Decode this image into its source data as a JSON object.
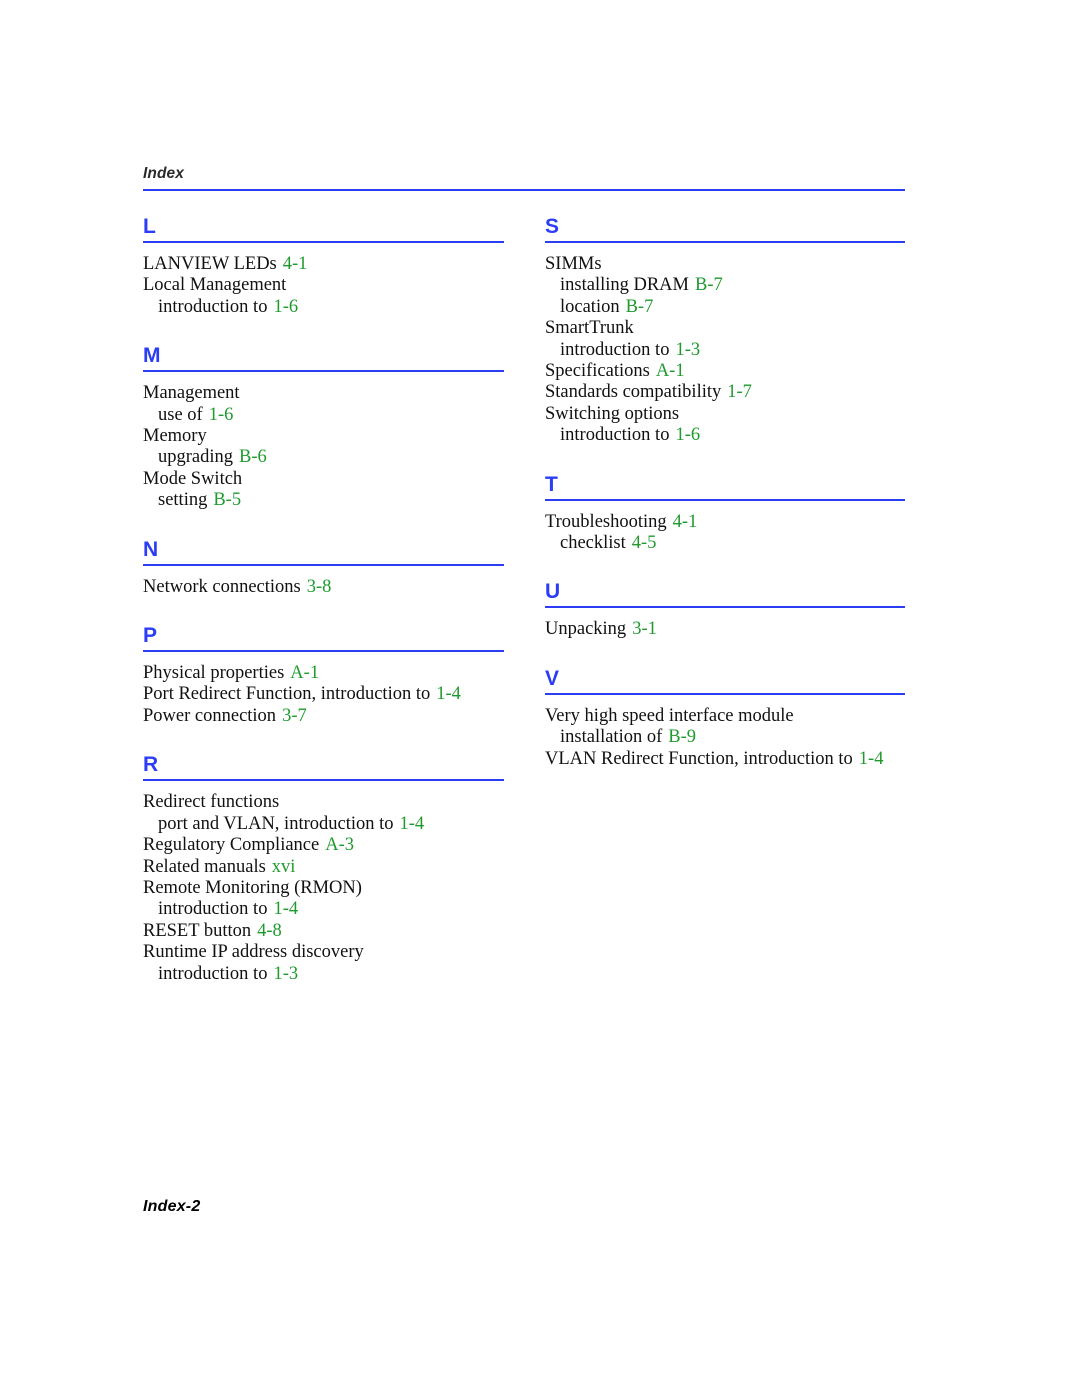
{
  "header": {
    "title": "Index"
  },
  "footer": {
    "page_label": "Index-2"
  },
  "colors": {
    "accent_blue": "#2b3df5",
    "page_number_green": "#1f9b2e",
    "body_text": "#111111"
  },
  "columns": [
    {
      "name": "left-column",
      "sections": [
        {
          "letter": "L",
          "entries": [
            {
              "term": "LANVIEW LEDs",
              "page": "4-1",
              "level": 0
            },
            {
              "term": "Local Management",
              "page": "",
              "level": 0
            },
            {
              "term": "introduction to",
              "page": "1-6",
              "level": 1
            }
          ]
        },
        {
          "letter": "M",
          "entries": [
            {
              "term": "Management",
              "page": "",
              "level": 0
            },
            {
              "term": "use of",
              "page": "1-6",
              "level": 1
            },
            {
              "term": "Memory",
              "page": "",
              "level": 0
            },
            {
              "term": "upgrading",
              "page": "B-6",
              "level": 1
            },
            {
              "term": "Mode Switch",
              "page": "",
              "level": 0
            },
            {
              "term": "setting",
              "page": "B-5",
              "level": 1
            }
          ]
        },
        {
          "letter": "N",
          "entries": [
            {
              "term": "Network connections",
              "page": "3-8",
              "level": 0
            }
          ]
        },
        {
          "letter": "P",
          "entries": [
            {
              "term": "Physical properties",
              "page": "A-1",
              "level": 0
            },
            {
              "term": "Port Redirect Function, introduction to",
              "page": "1-4",
              "level": 0
            },
            {
              "term": "Power connection",
              "page": "3-7",
              "level": 0
            }
          ]
        },
        {
          "letter": "R",
          "entries": [
            {
              "term": "Redirect functions",
              "page": "",
              "level": 0
            },
            {
              "term": "port and VLAN, introduction to",
              "page": "1-4",
              "level": 1
            },
            {
              "term": "Regulatory Compliance",
              "page": "A-3",
              "level": 0
            },
            {
              "term": "Related manuals",
              "page": "xvi",
              "level": 0
            },
            {
              "term": "Remote Monitoring (RMON)",
              "page": "",
              "level": 0
            },
            {
              "term": "introduction to",
              "page": "1-4",
              "level": 1
            },
            {
              "term": "RESET button",
              "page": "4-8",
              "level": 0
            },
            {
              "term": "Runtime IP address discovery",
              "page": "",
              "level": 0
            },
            {
              "term": "introduction to",
              "page": "1-3",
              "level": 1
            }
          ]
        }
      ]
    },
    {
      "name": "right-column",
      "sections": [
        {
          "letter": "S",
          "entries": [
            {
              "term": "SIMMs",
              "page": "",
              "level": 0
            },
            {
              "term": "installing DRAM",
              "page": "B-7",
              "level": 1
            },
            {
              "term": "location",
              "page": "B-7",
              "level": 1
            },
            {
              "term": "SmartTrunk",
              "page": "",
              "level": 0
            },
            {
              "term": "introduction to",
              "page": "1-3",
              "level": 1
            },
            {
              "term": "Specifications",
              "page": "A-1",
              "level": 0
            },
            {
              "term": "Standards compatibility",
              "page": "1-7",
              "level": 0
            },
            {
              "term": "Switching options",
              "page": "",
              "level": 0
            },
            {
              "term": "introduction to",
              "page": "1-6",
              "level": 1
            }
          ]
        },
        {
          "letter": "T",
          "entries": [
            {
              "term": "Troubleshooting",
              "page": "4-1",
              "level": 0
            },
            {
              "term": "checklist",
              "page": "4-5",
              "level": 1
            }
          ]
        },
        {
          "letter": "U",
          "entries": [
            {
              "term": "Unpacking",
              "page": "3-1",
              "level": 0
            }
          ]
        },
        {
          "letter": "V",
          "entries": [
            {
              "term": "Very high speed interface module",
              "page": "",
              "level": 0
            },
            {
              "term": "installation of",
              "page": "B-9",
              "level": 1
            },
            {
              "term": "VLAN Redirect Function, introduction to",
              "page": "1-4",
              "level": 0
            }
          ]
        }
      ]
    }
  ]
}
